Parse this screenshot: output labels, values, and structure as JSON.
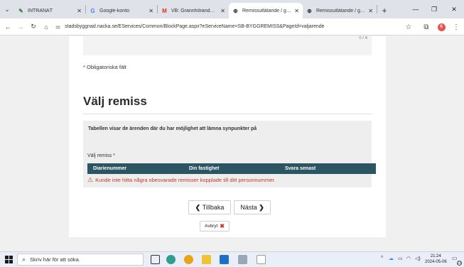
{
  "browser": {
    "tabs": [
      {
        "title": "INTRANÄT",
        "icon": "intranet-icon"
      },
      {
        "title": "Google-konto",
        "icon": "google-icon"
      },
      {
        "title": "VB: Grannhörande, utskick",
        "icon": "gmail-icon"
      },
      {
        "title": "Remissutlåtande / granne",
        "icon": "globe-icon"
      },
      {
        "title": "Remissutlåtande / granne",
        "icon": "globe-icon"
      }
    ],
    "url": "stadsbyggnad.nacka.se/EServices/Common/BlockPage.aspx?eServiceName=SB-BYGGREMISS&PageId=valjarende",
    "profile_letter": "0"
  },
  "page": {
    "top_counter": "0 / 4",
    "required_note": "* Obligatoriska fält",
    "heading": "Välj remiss",
    "info_text": "Tabellen visar de ärenden där du har möjlighet att lämna synpunkter på",
    "select_label": "Välj remiss *",
    "table": {
      "headers": [
        "Diarienummer",
        "Din fastighet",
        "Svara senast"
      ]
    },
    "error": "Kunde inte hitta några obesvarade remisser kopplade till ditt personnummer.",
    "buttons": {
      "back": "Tillbaka",
      "next": "Nästa",
      "cancel": "Avbryt"
    }
  },
  "taskbar": {
    "search_placeholder": "Skriv här för att söka.",
    "time": "21:24",
    "date": "2024-05-06",
    "notifications": "23"
  },
  "colors": {
    "table_header": "#2b5563",
    "error": "#c0392b",
    "cancel_x": "#d0312d"
  }
}
